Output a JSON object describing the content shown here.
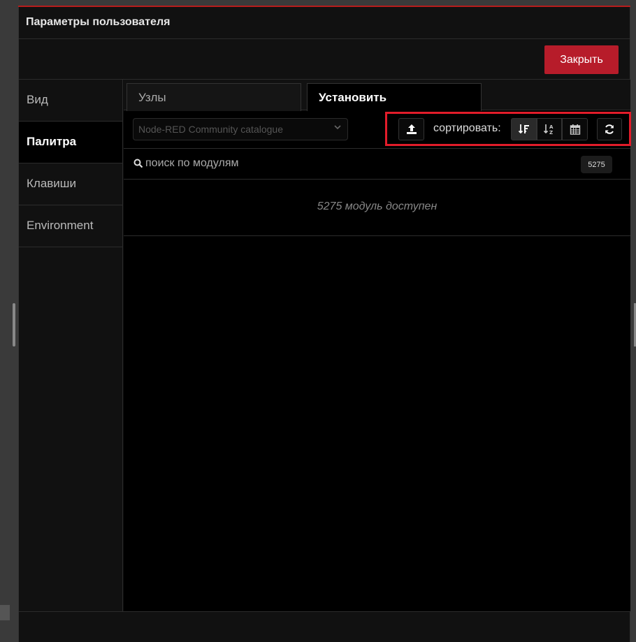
{
  "dialog": {
    "title": "Параметры пользователя",
    "close_label": "Закрыть"
  },
  "sidebar": {
    "items": [
      {
        "label": "Вид",
        "active": false
      },
      {
        "label": "Палитра",
        "active": true
      },
      {
        "label": "Клавиши",
        "active": false
      },
      {
        "label": "Environment",
        "active": false
      }
    ]
  },
  "tabs": [
    {
      "label": "Узлы",
      "active": false
    },
    {
      "label": "Установить",
      "active": true
    }
  ],
  "toolbar": {
    "catalog_value": "Node-RED Community catalogue",
    "sort_label": "сортировать:",
    "icons": [
      "upload-icon",
      "sort-relevance-icon",
      "sort-alpha-icon",
      "calendar-icon",
      "refresh-icon"
    ]
  },
  "search": {
    "placeholder": "поиск по модулям",
    "count": "5275"
  },
  "status": {
    "message": "5275 модуль доступен"
  },
  "colors": {
    "accent_red": "#b71c2a",
    "highlight_red": "#e21c2a",
    "background": "#000000"
  }
}
